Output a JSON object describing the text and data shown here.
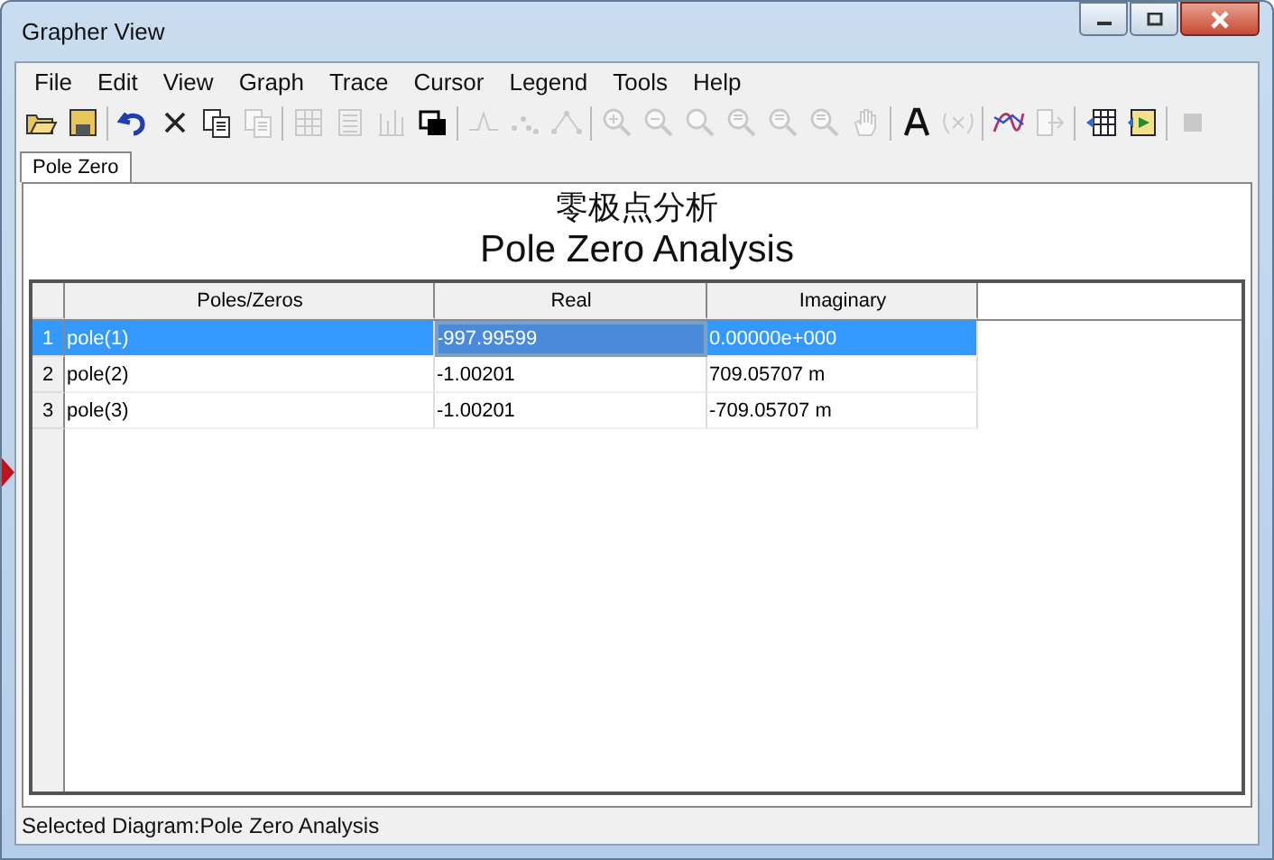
{
  "window": {
    "title": "Grapher View"
  },
  "menu": [
    "File",
    "Edit",
    "View",
    "Graph",
    "Trace",
    "Cursor",
    "Legend",
    "Tools",
    "Help"
  ],
  "toolbar": [
    {
      "kind": "open",
      "disabled": false
    },
    {
      "kind": "save",
      "disabled": false
    },
    {
      "kind": "separator"
    },
    {
      "kind": "undo",
      "disabled": false
    },
    {
      "kind": "delete",
      "disabled": false
    },
    {
      "kind": "copy",
      "disabled": false
    },
    {
      "kind": "paste",
      "disabled": true
    },
    {
      "kind": "separator"
    },
    {
      "kind": "grid",
      "disabled": true
    },
    {
      "kind": "list",
      "disabled": true
    },
    {
      "kind": "bars",
      "disabled": true
    },
    {
      "kind": "windows",
      "disabled": false
    },
    {
      "kind": "separator"
    },
    {
      "kind": "peak",
      "disabled": true
    },
    {
      "kind": "dots",
      "disabled": true
    },
    {
      "kind": "linedots",
      "disabled": true
    },
    {
      "kind": "separator"
    },
    {
      "kind": "zoomin",
      "disabled": true
    },
    {
      "kind": "zoomout",
      "disabled": true
    },
    {
      "kind": "zoomfit",
      "disabled": true
    },
    {
      "kind": "zoomx",
      "disabled": true
    },
    {
      "kind": "zoomx",
      "disabled": true
    },
    {
      "kind": "zoomx",
      "disabled": true
    },
    {
      "kind": "hand",
      "disabled": true
    },
    {
      "kind": "separator"
    },
    {
      "kind": "text",
      "disabled": false
    },
    {
      "kind": "xy",
      "disabled": true
    },
    {
      "kind": "separator"
    },
    {
      "kind": "curve",
      "disabled": false
    },
    {
      "kind": "export",
      "disabled": true
    },
    {
      "kind": "separator"
    },
    {
      "kind": "tableexport",
      "disabled": false
    },
    {
      "kind": "run",
      "disabled": false
    },
    {
      "kind": "separator"
    },
    {
      "kind": "stop",
      "disabled": true
    }
  ],
  "tabs": [
    {
      "label": "Pole Zero",
      "selected": true
    }
  ],
  "title_cn": "零极点分析",
  "title": "Pole Zero Analysis",
  "table": {
    "columns": [
      "Poles/Zeros",
      "Real",
      "Imaginary"
    ],
    "rows": [
      {
        "number": "1",
        "selected": true,
        "cells": [
          "pole(1)",
          "-997.99599",
          "0.00000e+000"
        ]
      },
      {
        "number": "2",
        "selected": false,
        "cells": [
          "pole(2)",
          "-1.00201",
          "709.05707 m"
        ]
      },
      {
        "number": "3",
        "selected": false,
        "cells": [
          "pole(3)",
          "-1.00201",
          "-709.05707 m"
        ]
      }
    ]
  },
  "status_bar": "Selected Diagram:Pole Zero Analysis"
}
